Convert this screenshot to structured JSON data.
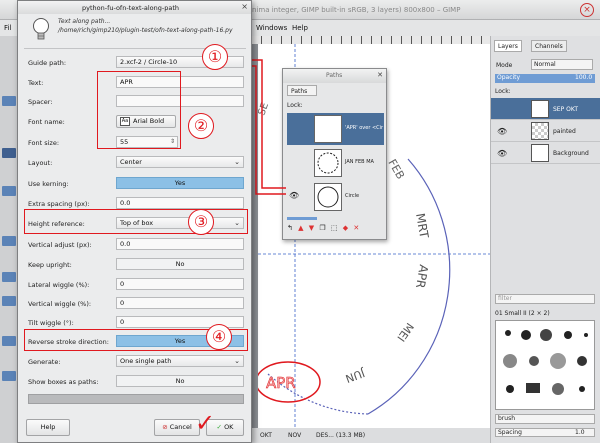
{
  "gimp": {
    "title": "nima integer, GIMP built-in sRGB, 3 layers) 800x800 – GIMP",
    "close_glyph": "×",
    "menu": [
      "Fil",
      "Windows",
      "Help"
    ],
    "status_left": "OKT",
    "status_mid": "NOV",
    "status_right": "DES... (13.3 MB)"
  },
  "layers_dock": {
    "tabs": [
      "Layers",
      "Channels"
    ],
    "mode_label": "Mode",
    "mode_value": "Normal",
    "opacity_label": "Opacity",
    "opacity_value": "100.0",
    "lock_label": "Lock:",
    "layers": [
      {
        "name": "SEP OKT",
        "selected": true
      },
      {
        "name": "painted",
        "selected": false
      },
      {
        "name": "Background",
        "selected": false
      }
    ]
  },
  "brushes_dock": {
    "filter_placeholder": "filter",
    "brush_name": "01 Small II (2 × 2)",
    "brush_tag": "brush",
    "spacing_label": "Spacing",
    "spacing_value": "1.0"
  },
  "paths_dialog": {
    "title": "Paths",
    "tab": "Paths",
    "lock_label": "Lock:",
    "paths": [
      {
        "label": "'APR' over <Cir",
        "selected": true
      },
      {
        "label": "JAN FEB MA",
        "selected": false
      },
      {
        "label": "Circle",
        "selected": false
      }
    ]
  },
  "plugin": {
    "title": "python-fu-ofn-text-along-path",
    "name": "Text along path...",
    "path": "/home/rich/gimp210/plugin-test/ofn-text-along-path-16.py",
    "close_glyph": "×",
    "fields": {
      "guide_path": {
        "label": "Guide path:",
        "value": "2.xcf-2 / Circle-10"
      },
      "text": {
        "label": "Text:",
        "value": "APR"
      },
      "spacer": {
        "label": "Spacer:",
        "value": ""
      },
      "font_name": {
        "label": "Font name:",
        "value": "Arial Bold"
      },
      "font_size": {
        "label": "Font size:",
        "value": "55"
      },
      "layout": {
        "label": "Layout:",
        "value": "Center"
      },
      "use_kerning": {
        "label": "Use kerning:",
        "value": "Yes"
      },
      "extra_spacing": {
        "label": "Extra spacing (px):",
        "value": "0.0"
      },
      "height_reference": {
        "label": "Height reference:",
        "value": "Top of box"
      },
      "vertical_adjust": {
        "label": "Vertical adjust (px):",
        "value": "0.0"
      },
      "keep_upright": {
        "label": "Keep upright:",
        "value": "No"
      },
      "lateral_wiggle": {
        "label": "Lateral wiggle (%):",
        "value": "0"
      },
      "vertical_wiggle": {
        "label": "Vertical wiggle (%):",
        "value": "0"
      },
      "tilt_wiggle": {
        "label": "Tilt wiggle (°):",
        "value": "0"
      },
      "reverse_stroke": {
        "label": "Reverse stroke direction:",
        "value": "Yes"
      },
      "generate": {
        "label": "Generate:",
        "value": "One single path"
      },
      "show_boxes": {
        "label": "Show boxes as paths:",
        "value": "No"
      }
    },
    "buttons": {
      "help": "Help",
      "cancel": "Cancel",
      "ok": "OK"
    }
  },
  "annotations": {
    "callouts": [
      "①",
      "②",
      "③",
      "④"
    ],
    "canvas_letters": [
      "SE",
      "FEB",
      "MRT",
      "APR",
      "MEI",
      "JUN"
    ],
    "circled_text": "APR",
    "checkmark": "✓"
  },
  "colors": {
    "accent_red": "#e0191f",
    "toggle_blue": "#8cc0e6",
    "selection_blue": "#4a6f9a"
  }
}
